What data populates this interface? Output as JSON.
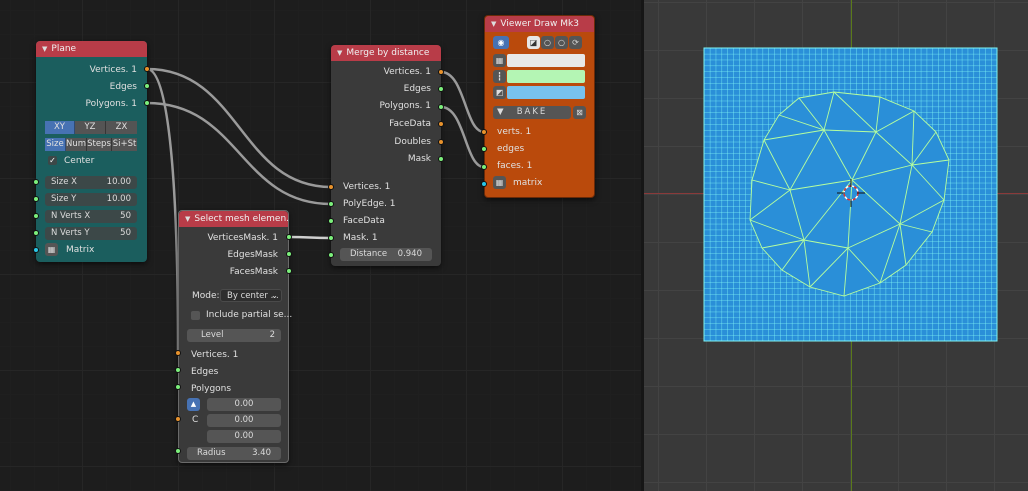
{
  "plane": {
    "title": "Plane",
    "outputs": [
      "Vertices. 1",
      "Edges",
      "Polygons. 1"
    ],
    "axis_buttons": [
      "XY",
      "YZ",
      "ZX"
    ],
    "mode_buttons": [
      "Size",
      "Num",
      "Steps",
      "Si+St"
    ],
    "center_label": "Center",
    "fields": [
      {
        "label": "Size X",
        "value": "10.00"
      },
      {
        "label": "Size Y",
        "value": "10.00"
      },
      {
        "label": "N Verts X",
        "value": "50"
      },
      {
        "label": "N Verts Y",
        "value": "50"
      }
    ],
    "matrix_label": "Matrix"
  },
  "select": {
    "title": "Select mesh elemen...",
    "outputs": [
      "VerticesMask. 1",
      "EdgesMask",
      "FacesMask"
    ],
    "mode_label": "Mode:",
    "mode_value": "By center ...",
    "include_partial": "Include partial se...",
    "level_label": "Level",
    "level_value": "2",
    "inputs": [
      "Vertices. 1",
      "Edges",
      "Polygons"
    ],
    "vector": [
      "0.00",
      "0.00",
      "0.00"
    ],
    "c_label": "C",
    "radius_label": "Radius",
    "radius_value": "3.40"
  },
  "merge": {
    "title": "Merge by distance",
    "outputs": [
      "Vertices. 1",
      "Edges",
      "Polygons. 1",
      "FaceData",
      "Doubles",
      "Mask"
    ],
    "inputs": [
      "Vertices. 1",
      "PolyEdge. 1",
      "FaceData",
      "Mask. 1"
    ],
    "distance_label": "Distance",
    "distance_value": "0.940"
  },
  "viewer": {
    "title": "Viewer Draw Mk3",
    "bake_label": "BAKE",
    "inputs": [
      "verts. 1",
      "edges",
      "faces. 1",
      "matrix"
    ],
    "colors": {
      "vertex": "#e8e8e8",
      "edge": "#b4f5b4",
      "face": "#78c2ee"
    }
  },
  "colors": {
    "socket_vertices": "#e8922c",
    "socket_generic": "#7cf07c",
    "socket_matrix": "#29c6e6",
    "node_header": "#b83c48",
    "plane_body": "#1b5e5e",
    "viewer_body": "#ba4a0c",
    "mesh_fill": "#2a8fd8",
    "grid_edges": "#7ef5f5",
    "selected_edges": "#b6ff9e"
  },
  "icons": {
    "eye": "eye-icon",
    "bake": "bake-icon",
    "matrix": "matrix-icon",
    "vertex": "vertex-icon",
    "edge": "edge-icon",
    "face": "face-icon",
    "cursor": "3d-cursor-icon"
  }
}
